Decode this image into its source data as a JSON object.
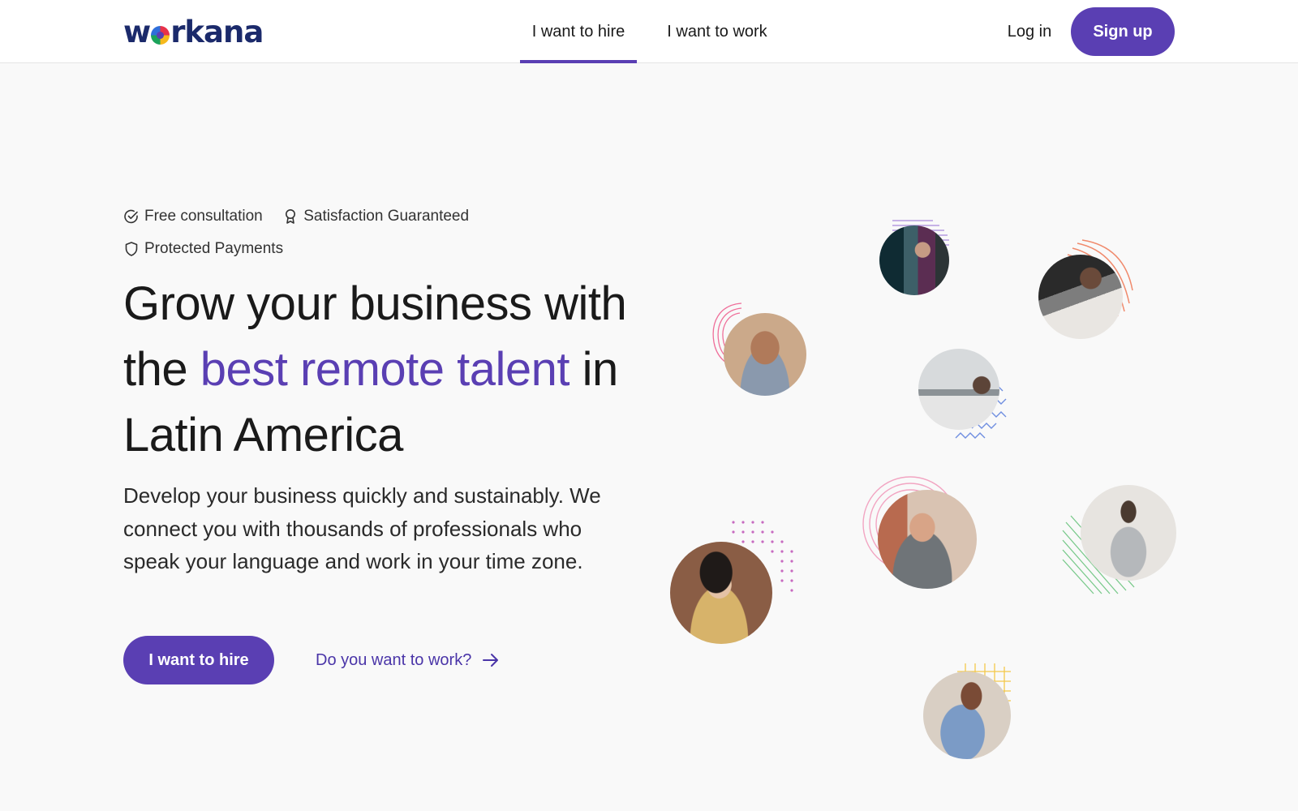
{
  "header": {
    "logo_text_before": "w",
    "logo_text_after": "rkana",
    "tabs": [
      {
        "label": "I want to hire",
        "active": true
      },
      {
        "label": "I want to work",
        "active": false
      }
    ],
    "login_label": "Log in",
    "signup_label": "Sign up"
  },
  "hero": {
    "badges": [
      {
        "icon": "check-circle-icon",
        "label": "Free consultation"
      },
      {
        "icon": "award-icon",
        "label": "Satisfaction Guaranteed"
      },
      {
        "icon": "shield-icon",
        "label": "Protected Payments"
      }
    ],
    "headline_part1": "Grow your business with the ",
    "headline_accent": "best remote talent",
    "headline_part2": " in Latin America",
    "description": "Develop your business quickly and sustainably. We connect you with thousands of professionals who speak your language and work in your time zone.",
    "cta_hire_label": "I want to hire",
    "cta_work_label": "Do you want to work?"
  },
  "colors": {
    "brand_purple": "#5a3fb3",
    "logo_navy": "#1b2a6b",
    "page_background": "#f9f9f9"
  }
}
